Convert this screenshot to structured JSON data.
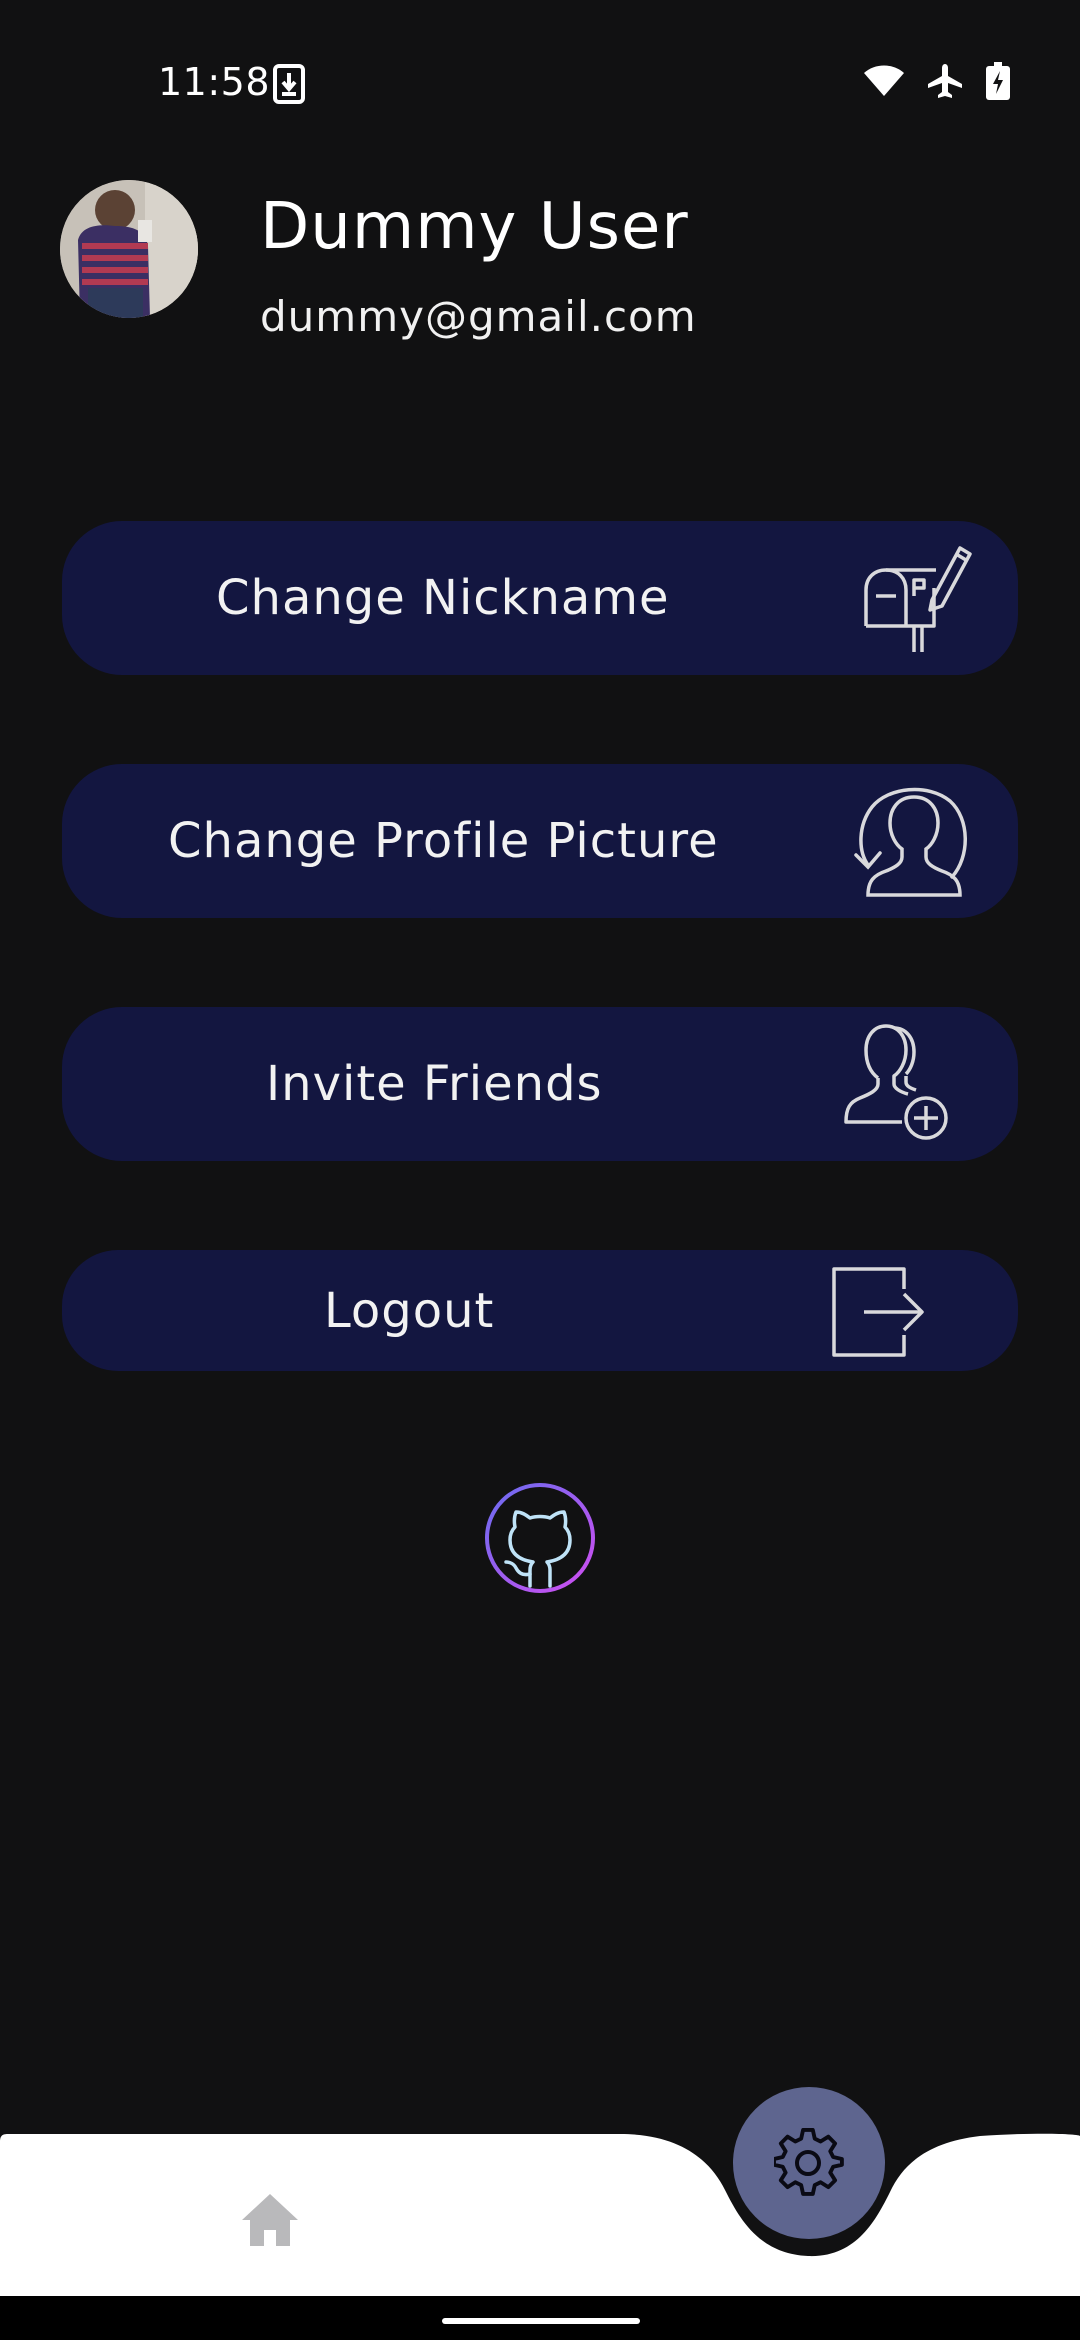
{
  "status_bar": {
    "time": "11:58",
    "icons": [
      "download-notification-icon",
      "wifi-icon",
      "airplane-mode-icon",
      "battery-charging-icon"
    ]
  },
  "profile": {
    "name": "Dummy User",
    "email": "dummy@gmail.com"
  },
  "menu": {
    "items": [
      {
        "label": "Change Nickname",
        "icon": "mailbox-edit-icon"
      },
      {
        "label": "Change Profile Picture",
        "icon": "profile-refresh-icon"
      },
      {
        "label": "Invite Friends",
        "icon": "add-friend-icon"
      },
      {
        "label": "Logout",
        "icon": "logout-icon"
      }
    ]
  },
  "footer": {
    "icon": "github-icon"
  },
  "bottom_nav": {
    "items": [
      {
        "name": "home",
        "icon": "home-icon",
        "active": false
      },
      {
        "name": "settings",
        "icon": "gear-icon",
        "active": true
      }
    ]
  },
  "colors": {
    "background": "#111112",
    "button_bg": "#131640",
    "fab": "#5e658f",
    "nav_bg": "#ffffff"
  }
}
